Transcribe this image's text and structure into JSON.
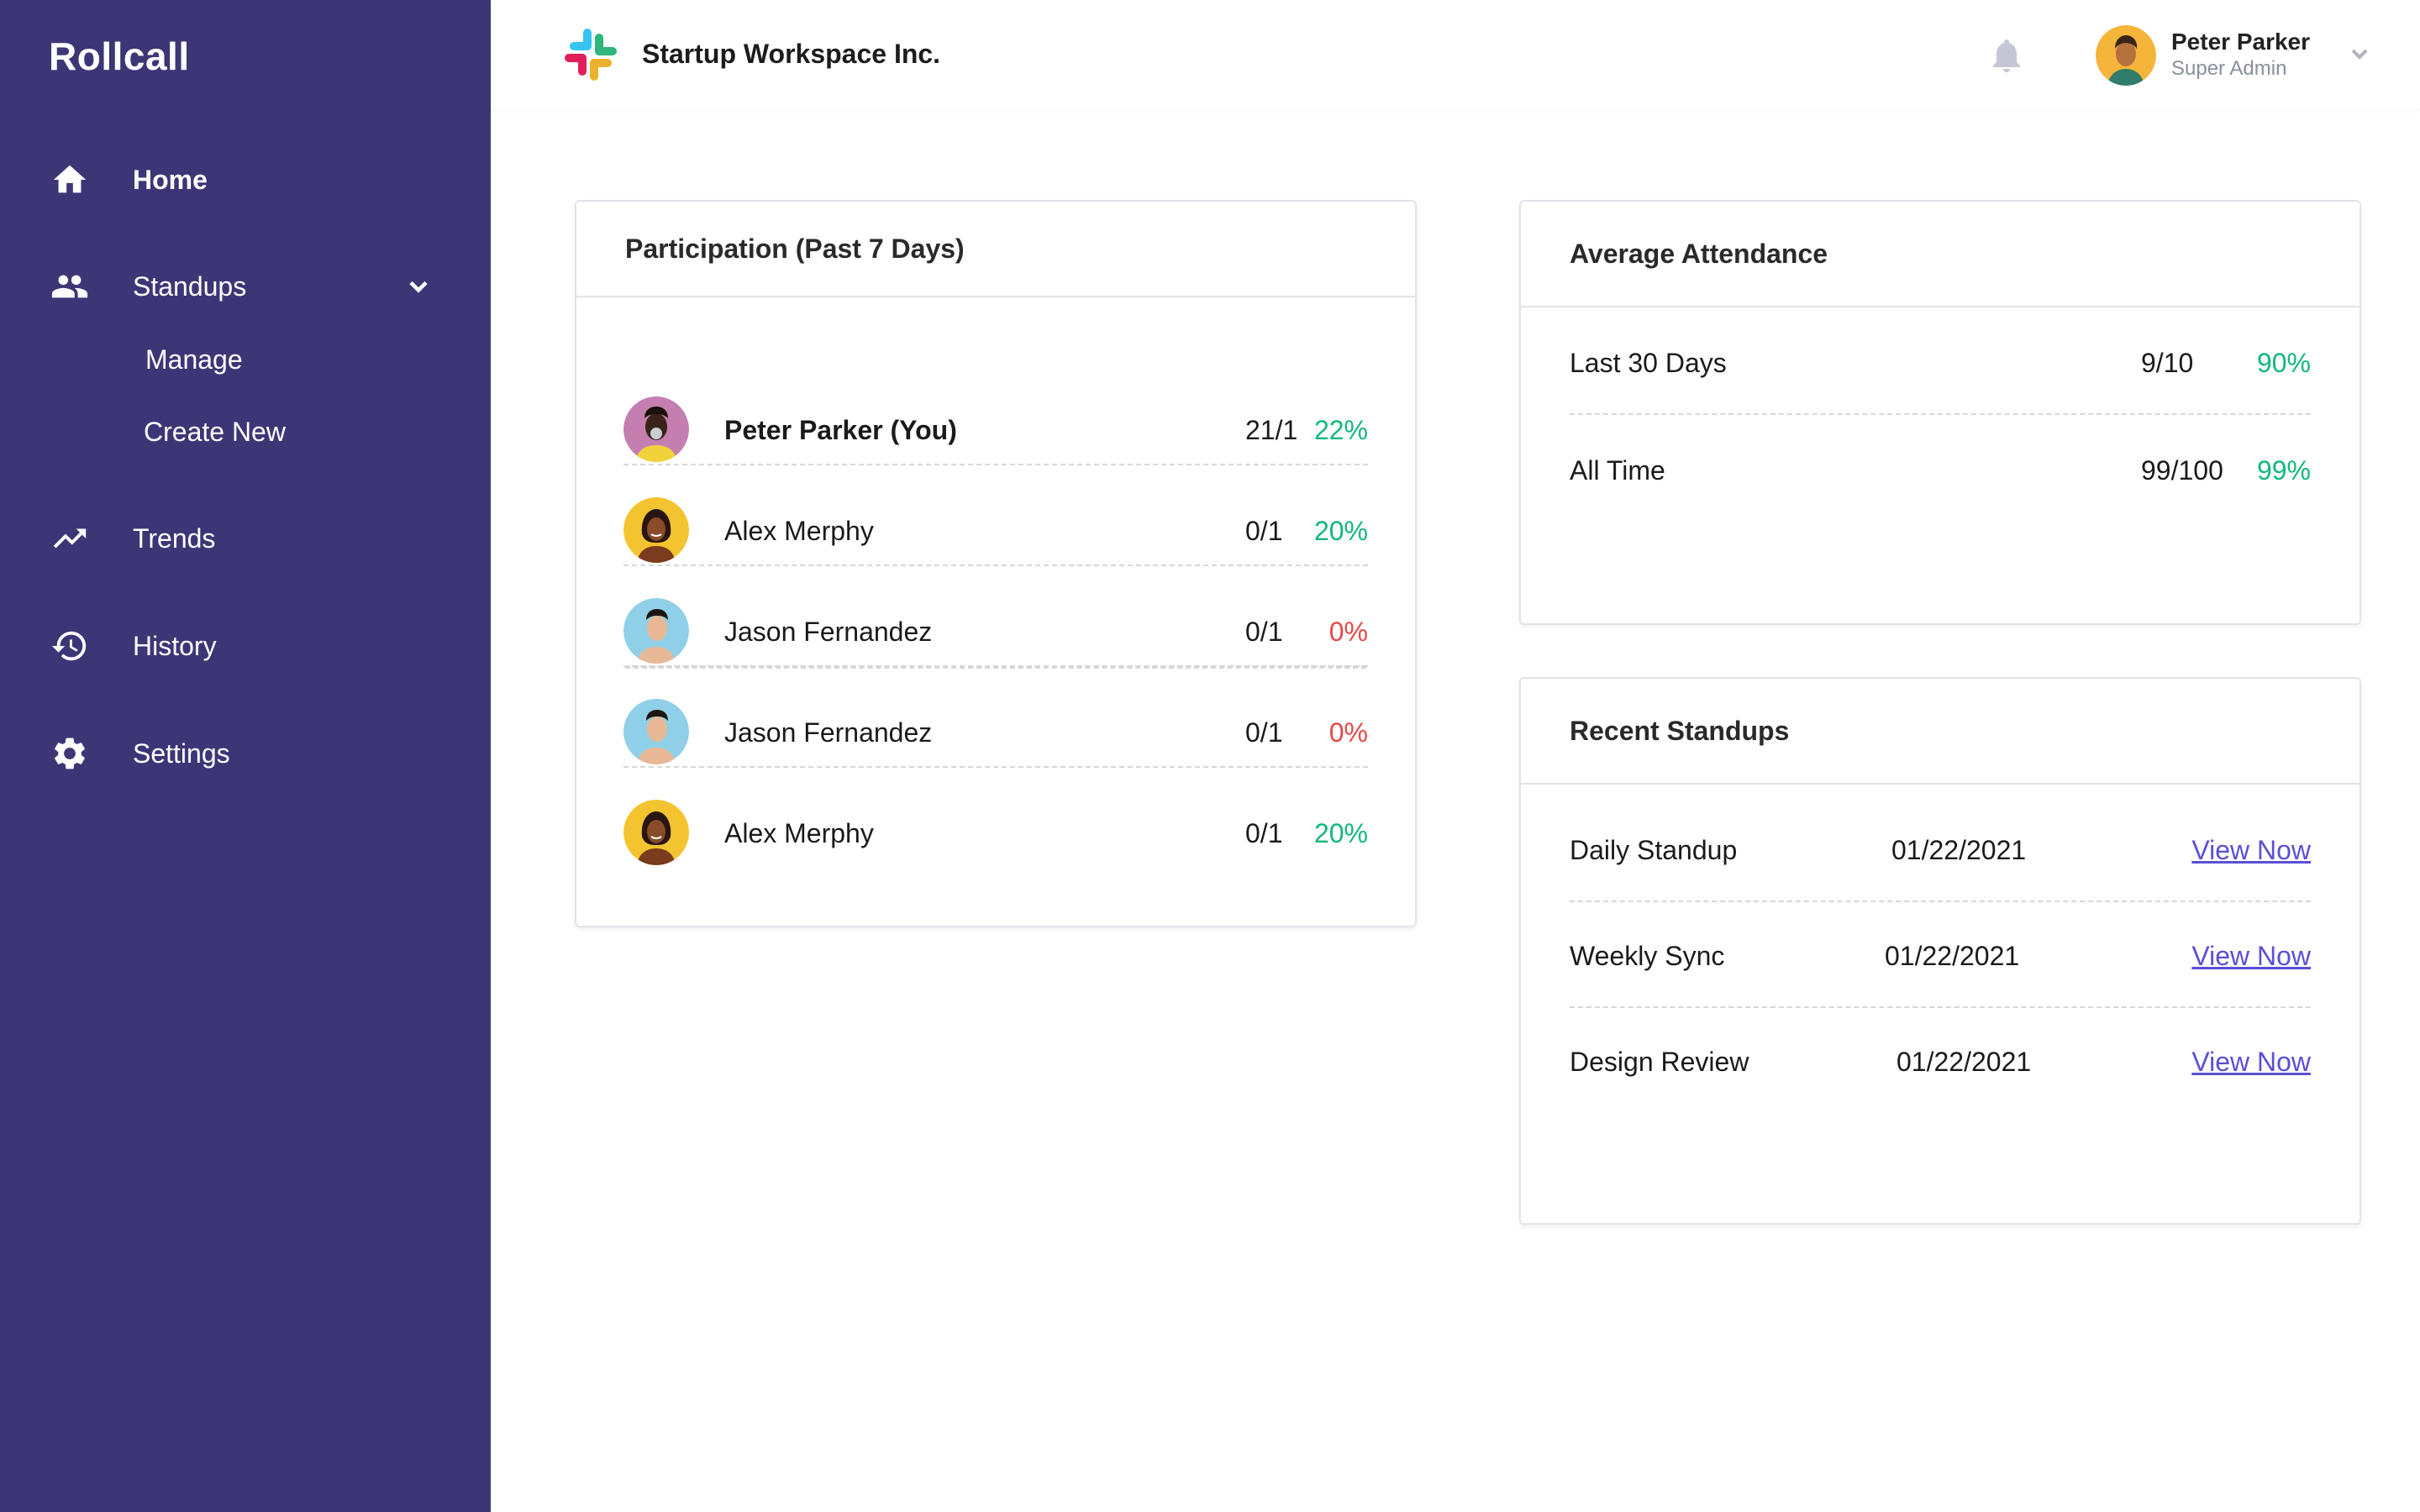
{
  "app": {
    "logo_text": "Rollcall"
  },
  "sidebar": {
    "items": [
      {
        "label": "Home",
        "icon": "home-icon"
      },
      {
        "label": "Standups",
        "icon": "people-icon"
      },
      {
        "label": "Trends",
        "icon": "trend-icon"
      },
      {
        "label": "History",
        "icon": "history-icon"
      },
      {
        "label": "Settings",
        "icon": "gear-icon"
      }
    ],
    "standups_sub": [
      {
        "label": "Manage"
      },
      {
        "label": "Create New"
      }
    ],
    "bg_color": "#3d3676"
  },
  "header": {
    "workspace_name": "Startup Workspace Inc.",
    "user": {
      "name": "Peter Parker",
      "role": "Super Admin"
    }
  },
  "participation": {
    "title": "Participation (Past 7 Days)",
    "rows": [
      {
        "name": "Peter Parker (You)",
        "ratio": "21/1",
        "percent": "22%",
        "status": "good"
      },
      {
        "name": "Alex Merphy",
        "ratio": "0/1",
        "percent": "20%",
        "status": "good"
      },
      {
        "name": "Jason Fernandez",
        "ratio": "0/1",
        "percent": "0%",
        "status": "bad"
      },
      {
        "name": "Jason Fernandez",
        "ratio": "0/1",
        "percent": "0%",
        "status": "bad"
      },
      {
        "name": "Alex Merphy",
        "ratio": "0/1",
        "percent": "20%",
        "status": "good"
      }
    ]
  },
  "attendance": {
    "title": "Average Attendance",
    "rows": [
      {
        "label": "Last 30 Days",
        "ratio": "9/10",
        "percent": "90%"
      },
      {
        "label": "All Time",
        "ratio": "99/100",
        "percent": "99%"
      }
    ]
  },
  "recent": {
    "title": "Recent Standups",
    "rows": [
      {
        "name": "Daily Standup",
        "date": "01/22/2021",
        "link": "View Now"
      },
      {
        "name": "Weekly Sync",
        "date": "01/22/2021",
        "link": "View Now"
      },
      {
        "name": "Design Review",
        "date": "01/22/2021",
        "link": "View Now"
      }
    ]
  },
  "colors": {
    "accent": "#5b4fd6",
    "positive": "#13b87a",
    "negative": "#e84848"
  }
}
